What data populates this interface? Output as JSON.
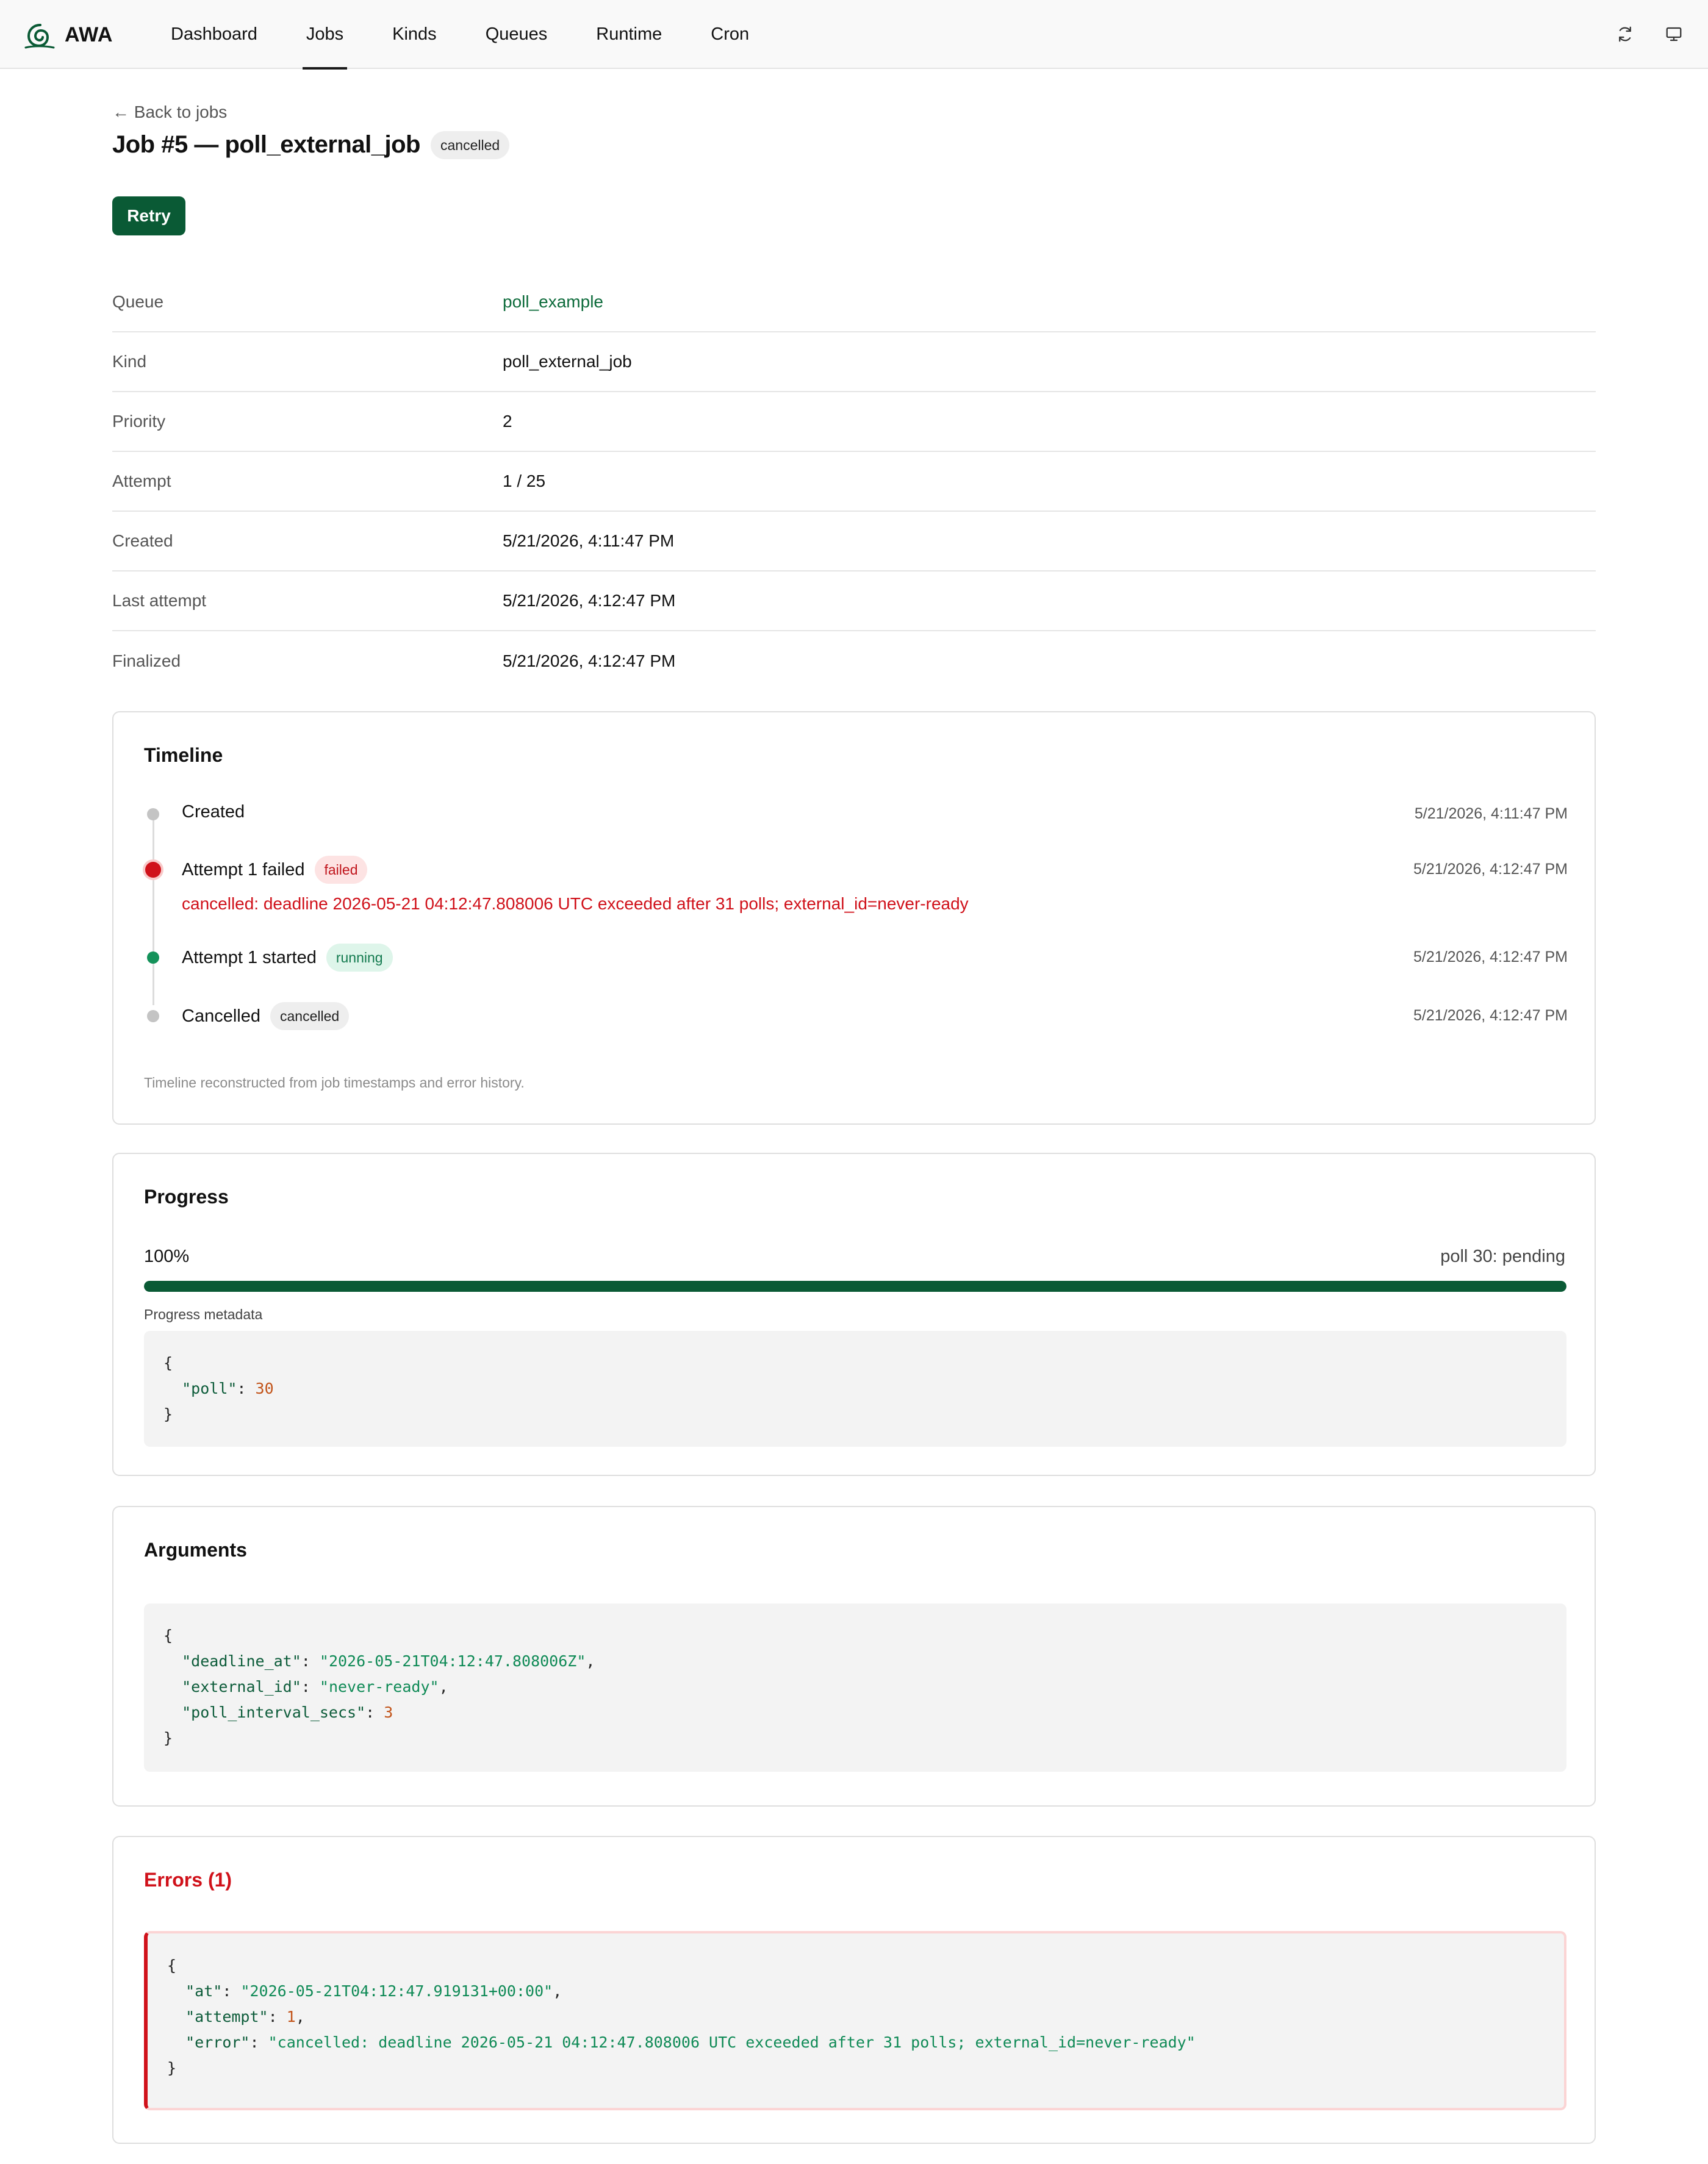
{
  "app": {
    "name": "AWA",
    "nav": [
      {
        "label": "Dashboard",
        "active": false
      },
      {
        "label": "Jobs",
        "active": true
      },
      {
        "label": "Kinds",
        "active": false
      },
      {
        "label": "Queues",
        "active": false
      },
      {
        "label": "Runtime",
        "active": false
      },
      {
        "label": "Cron",
        "active": false
      }
    ],
    "actions": {
      "refresh_icon": "refresh-icon",
      "monitor_icon": "monitor-icon"
    },
    "brand_color": "#0a5a35"
  },
  "header": {
    "back_label": "← Back to jobs",
    "title": "Job #5 — poll_external_job",
    "state_badge": "cancelled",
    "retry_label": "Retry"
  },
  "details": [
    {
      "label": "Queue",
      "value": "poll_example",
      "link": true
    },
    {
      "label": "Kind",
      "value": "poll_external_job",
      "link": false
    },
    {
      "label": "Priority",
      "value": "2",
      "link": false
    },
    {
      "label": "Attempt",
      "value": "1 / 25",
      "link": false
    },
    {
      "label": "Created",
      "value": "5/21/2026, 4:11:47 PM",
      "link": false
    },
    {
      "label": "Last attempt",
      "value": "5/21/2026, 4:12:47 PM",
      "link": false
    },
    {
      "label": "Finalized",
      "value": "5/21/2026, 4:12:47 PM",
      "link": false
    }
  ],
  "timeline": {
    "title": "Timeline",
    "events": [
      {
        "label": "Created",
        "badge": "",
        "time": "5/21/2026, 4:11:47 PM",
        "status": "neutral"
      },
      {
        "label": "Attempt 1 failed",
        "badge": "failed",
        "time": "5/21/2026, 4:12:47 PM",
        "status": "failed",
        "error": "cancelled: deadline 2026-05-21 04:12:47.808006 UTC exceeded after 31 polls; external_id=never-ready"
      },
      {
        "label": "Attempt 1 started",
        "badge": "running",
        "time": "5/21/2026, 4:12:47 PM",
        "status": "running"
      },
      {
        "label": "Cancelled",
        "badge": "cancelled",
        "time": "5/21/2026, 4:12:47 PM",
        "status": "cancelled"
      }
    ],
    "note": "Timeline reconstructed from job timestamps and error history."
  },
  "progress": {
    "title": "Progress",
    "percent_label": "100%",
    "percent": 100,
    "message": "poll 30: pending",
    "metadata_label": "Progress metadata",
    "metadata": {
      "poll": 30
    }
  },
  "arguments": {
    "title": "Arguments",
    "values": {
      "deadline_at": "2026-05-21T04:12:47.808006Z",
      "external_id": "never-ready",
      "poll_interval_secs": 3
    }
  },
  "errors": {
    "title": "Errors (1)",
    "items": [
      {
        "at": "2026-05-21T04:12:47.919131+00:00",
        "attempt": 1,
        "error": "cancelled: deadline 2026-05-21 04:12:47.808006 UTC exceeded after 31 polls; external_id=never-ready"
      }
    ]
  }
}
